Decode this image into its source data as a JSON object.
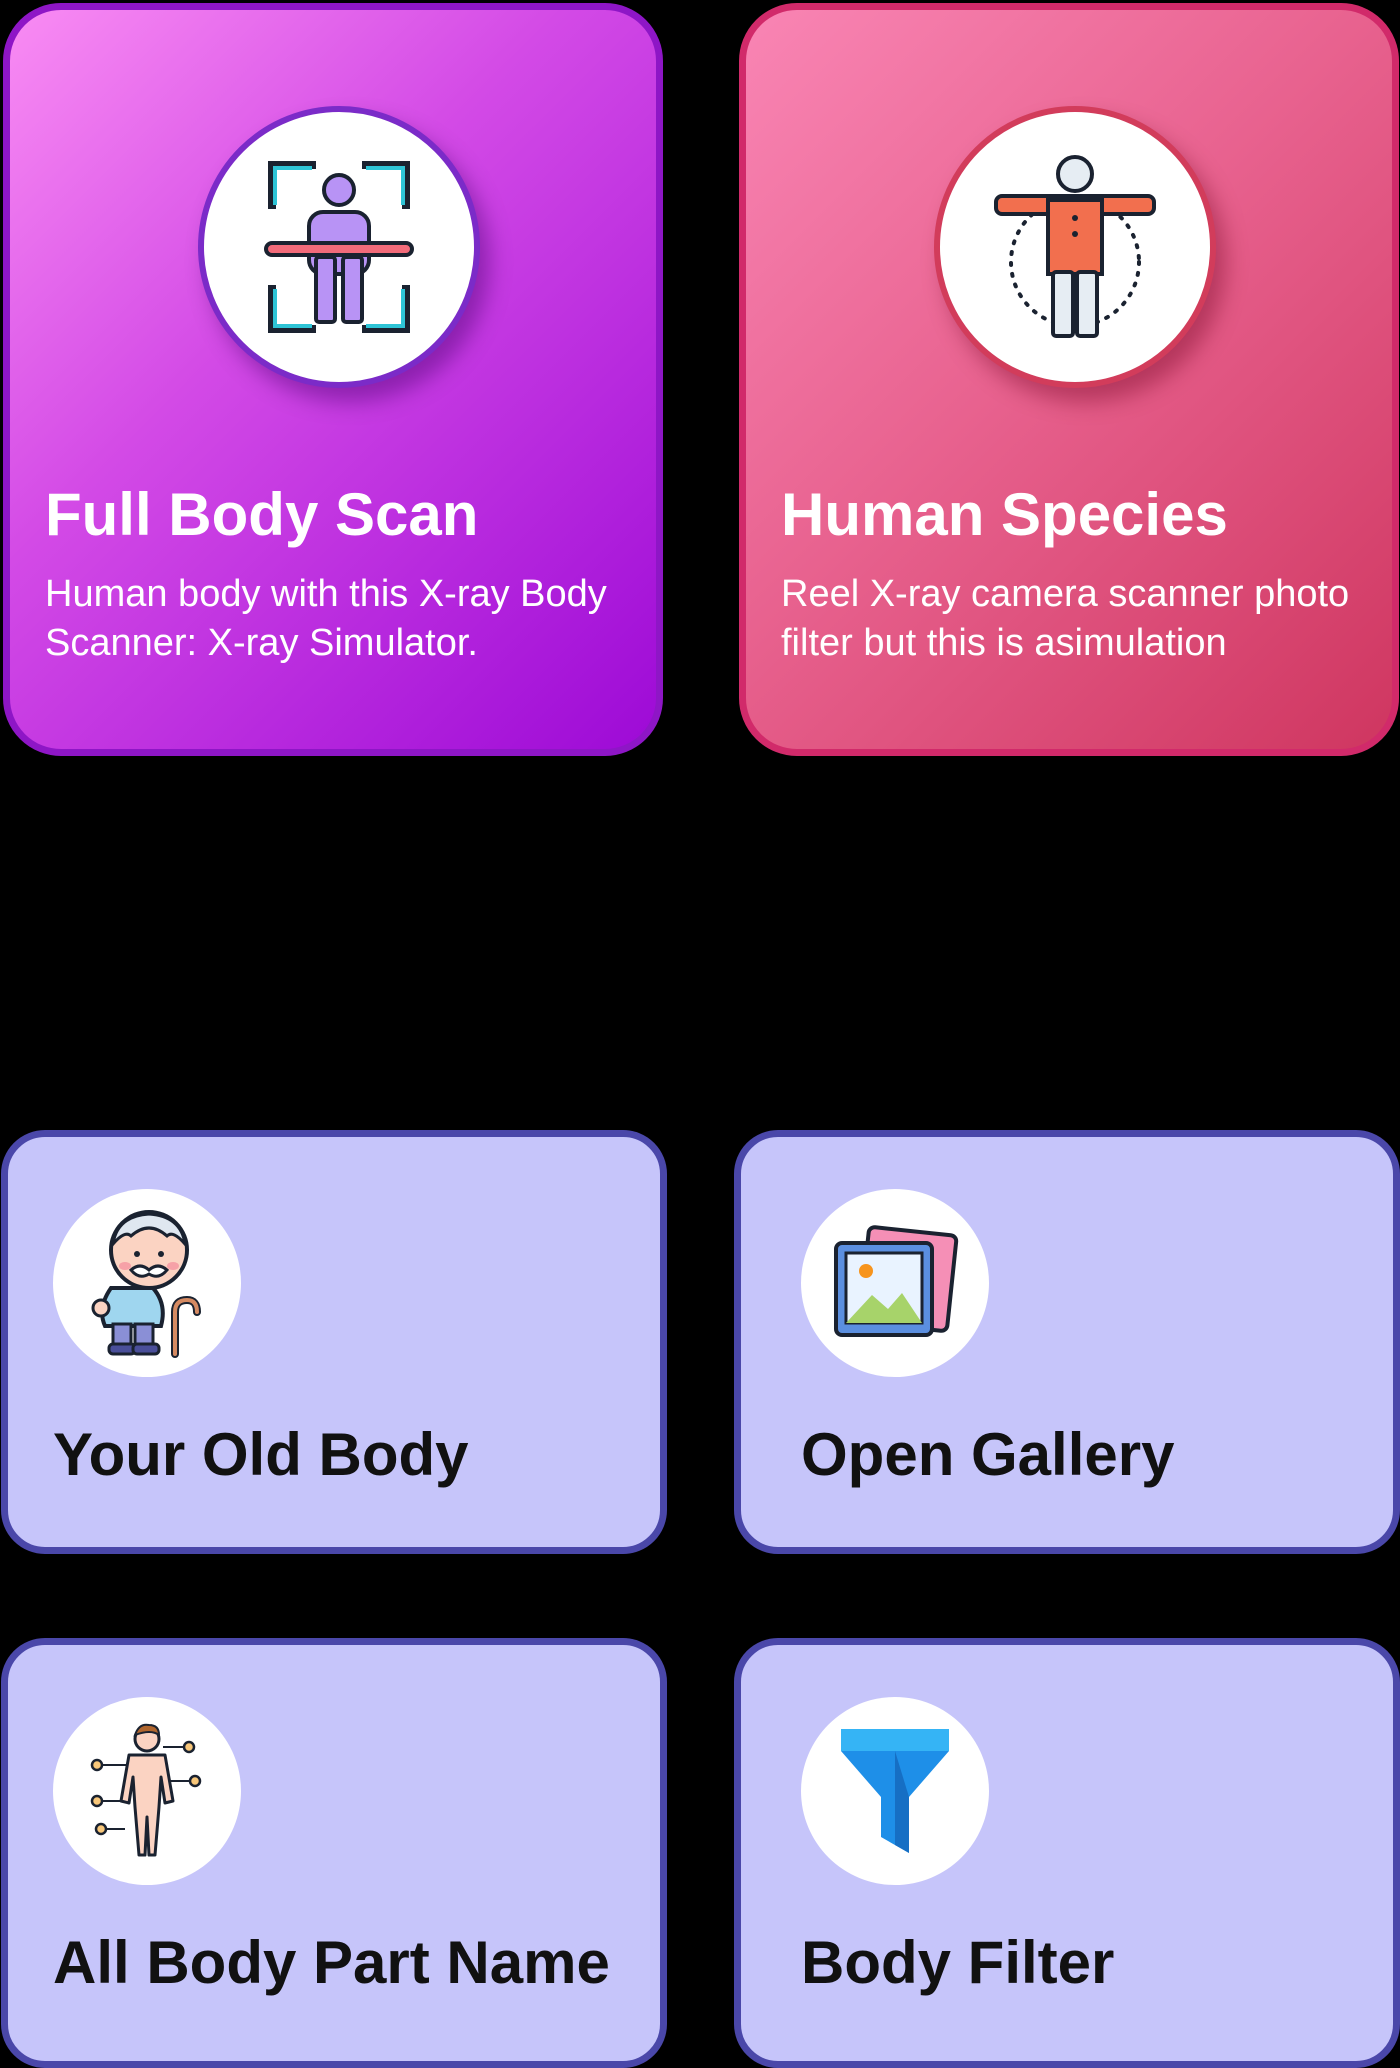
{
  "feature_cards": [
    {
      "title": "Full Body Scan",
      "description": "Human body with this X-ray Body Scanner: X-ray Simulator.",
      "icon": "body-scan-icon",
      "colors": {
        "gradient_start": "#f98cf3",
        "gradient_end": "#9d0ad6",
        "border": "#8e16c6"
      }
    },
    {
      "title": "Human Species",
      "description": "Reel X-ray camera scanner photo filter but this is asimulation",
      "icon": "human-body-icon",
      "colors": {
        "gradient_start": "#f985b4",
        "gradient_end": "#cf3660",
        "border": "#d12a6a"
      }
    }
  ],
  "menu_cards": [
    {
      "title": "Your Old Body",
      "icon": "old-man-icon"
    },
    {
      "title": "Open Gallery",
      "icon": "gallery-icon"
    },
    {
      "title": "All Body Part Name",
      "icon": "body-parts-icon"
    },
    {
      "title": "Body Filter",
      "icon": "filter-icon"
    }
  ],
  "theme": {
    "background": "#000000",
    "menu_card_fill": "#c6c5fa",
    "menu_card_border": "#4a47a9"
  }
}
